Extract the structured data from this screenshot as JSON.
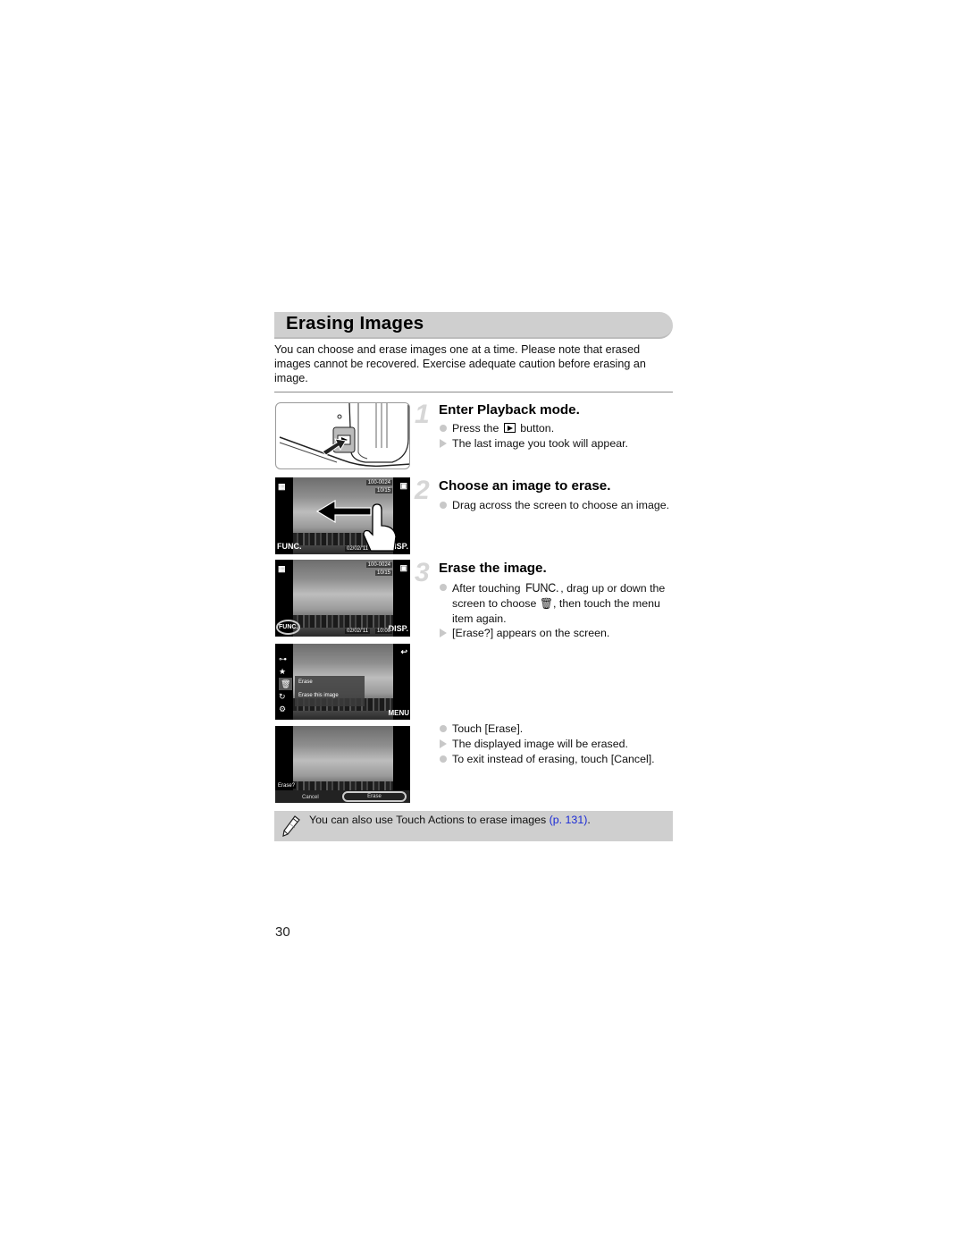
{
  "section": {
    "title": "Erasing Images",
    "intro": "You can choose and erase images one at a time. Please note that erased images cannot be recovered. Exercise adequate caution before erasing an image."
  },
  "steps": [
    {
      "number": "1",
      "title": "Enter Playback mode.",
      "bullets": [
        {
          "type": "action",
          "before": "Press the ",
          "icon": "playback-button-icon",
          "after": " button."
        },
        {
          "type": "result",
          "text": "The last image you took will appear."
        }
      ]
    },
    {
      "number": "2",
      "title": "Choose an image to erase.",
      "bullets": [
        {
          "type": "action",
          "text": "Drag across the screen to choose an image."
        }
      ]
    },
    {
      "number": "3",
      "title": "Erase the image.",
      "bullets": [
        {
          "type": "action",
          "before": "After touching ",
          "func": "FUNC.",
          "middle": ", drag up or down the screen to choose ",
          "trash": "🗑",
          "after": ", then touch the menu item again."
        },
        {
          "type": "result",
          "text": "[Erase?] appears on the screen."
        }
      ]
    },
    {
      "number": "",
      "title": "",
      "bullets": [
        {
          "type": "action",
          "text": "Touch [Erase]."
        },
        {
          "type": "result",
          "text": "The displayed image will be erased."
        },
        {
          "type": "action",
          "text": "To exit instead of erasing, touch [Cancel]."
        }
      ]
    }
  ],
  "screens": {
    "playback_screen": {
      "file_no": "100-0024",
      "count": "10/15",
      "date": "02/02/'11",
      "time": "10:00",
      "func_label": "FUNC.",
      "disp_label": "DISP."
    },
    "menu_screen": {
      "item_title": "Erase",
      "item_option": "Erase this image",
      "menu_label": "MENU"
    },
    "confirm_screen": {
      "prompt": "Erase?",
      "cancel_label": "Cancel",
      "erase_label": "Erase"
    }
  },
  "note": {
    "text": "You can also use Touch Actions to erase images ",
    "link": "(p. 131)",
    "suffix": "."
  },
  "page_number": "30"
}
